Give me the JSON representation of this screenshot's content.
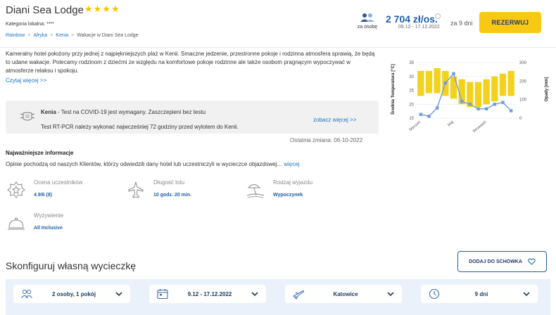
{
  "header": {
    "hotel_name": "Diani Sea Lodge",
    "stars_text": "★★★★",
    "stars_count": 4,
    "category": "Kategoria lokalna: ****",
    "breadcrumb": [
      {
        "label": "Rainbow"
      },
      {
        "label": "Afryka"
      },
      {
        "label": "Kenia"
      },
      {
        "label": "Wakacje w Diani Sea Lodge"
      }
    ],
    "breadcrumb_sep": ">",
    "persons_label": "za osobę",
    "price": "2 704 zł/os.",
    "price_dates": "09.12 - 17.12.2022",
    "nights": "za 9 dni",
    "book_label": "REZERWUJ"
  },
  "description": {
    "text": "Kameralny hotel położony przy jednej z najpiękniejszych plaż w Kenii. Smaczne jedzenie, przestronne pokoje i rodzinna atmosfera sprawią, że będą to udane wakacje. Polecamy rodzinom z dziećmi ze względu na komfortowe pokoje rodzinne ale także osobom pragnącym wypoczywać w atmosferze relaksu i spokoju.",
    "read_more": "Czytaj więcej >>"
  },
  "covid": {
    "title_strong": "Kenia",
    "title_rest": " - Test na COVID-19 jest wymagany. Zaszczepieni bez testu",
    "text": "Test RT-PCR należy wykonać najwcześniej 72 godziny przed wylotem do Kenii.",
    "more": "zobacz więcej >>",
    "last_change": "Ostatnia zmiana: 06-10-2022"
  },
  "important": {
    "title": "Najważniejsze informacje",
    "text": "Opinie pochodzą od naszych Klientów, którzy odwiedzili dany hotel lub uczestniczyli w wycieczce objazdowej...",
    "more": "więcej",
    "items": [
      {
        "label": "Ocena uczestników",
        "value": "4.9/6 (8)",
        "icon": "star-badge-icon"
      },
      {
        "label": "Długość lotu",
        "value": "10 godz. 20 min.",
        "icon": "airplane-icon"
      },
      {
        "label": "Rodzaj wyjazdu",
        "value": "Wypoczynek",
        "icon": "beach-icon"
      },
      {
        "label": "Wyżywienie",
        "value": "All Inclusive",
        "icon": "food-cloche-icon"
      }
    ]
  },
  "chart_data": {
    "type": "bar",
    "categories": [
      "1",
      "2",
      "3",
      "4",
      "5",
      "6",
      "7",
      "8",
      "9",
      "10",
      "11",
      "12"
    ],
    "tick_labels": [
      "Styczeń",
      "Maj",
      "Wrzesień"
    ],
    "series": [
      {
        "type": "bar",
        "axis": "left",
        "values_low": [
          23,
          24,
          24,
          23,
          22,
          20,
          19,
          19,
          20,
          21,
          23,
          23
        ],
        "values_high": [
          32,
          32,
          33,
          32,
          30,
          29,
          28,
          28,
          29,
          30,
          31,
          32
        ]
      },
      {
        "type": "line",
        "axis": "right",
        "values": [
          20,
          10,
          55,
          190,
          240,
          90,
          75,
          50,
          50,
          75,
          85,
          40
        ]
      }
    ],
    "ylabel_left": "Średnia Temperatura [°C]",
    "ylabel_right": "Opady [mm]",
    "ylim_left": [
      15,
      35
    ],
    "yticks_left": [
      15,
      20,
      25,
      30,
      35
    ],
    "ylim_right": [
      0,
      300
    ],
    "yticks_right": [
      0,
      100,
      200,
      300
    ],
    "colors": {
      "bar": "#f2d21b",
      "line": "#6f9be0"
    }
  },
  "config": {
    "title": "Skonfiguruj własną wycieczkę",
    "clipboard_label": "DODAJ DO SCHOWKA",
    "dropdowns": [
      {
        "label": "2 osoby, 1 pokój",
        "icon": "people-icon"
      },
      {
        "label": "9.12 - 17.12.2022",
        "icon": "calendar-icon"
      },
      {
        "label": "Katowice",
        "icon": "plane-departure-icon"
      },
      {
        "label": "9 dni",
        "icon": "clock-icon"
      }
    ]
  },
  "colors": {
    "accent": "#1f5fa7",
    "link": "#1a73c8",
    "button": "#f7c914",
    "star": "#f5c400"
  }
}
